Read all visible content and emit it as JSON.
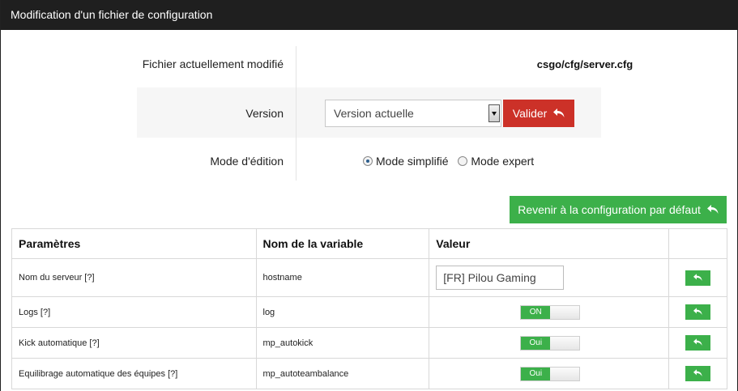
{
  "header": {
    "title": "Modification d'un fichier de configuration"
  },
  "info": {
    "file_label": "Fichier actuellement modifié",
    "file_value": "csgo/cfg/server.cfg",
    "version_label": "Version",
    "version_selected": "Version actuelle",
    "validate_label": "Valider",
    "mode_label": "Mode d'édition",
    "mode_simple": "Mode simplifié",
    "mode_expert": "Mode expert"
  },
  "reset_button": "Revenir à la configuration par défaut",
  "table": {
    "headers": [
      "Paramètres",
      "Nom de la variable",
      "Valeur",
      ""
    ],
    "rows": [
      {
        "param": "Nom du serveur [?]",
        "variable": "hostname",
        "value": "[FR] Pilou Gaming"
      },
      {
        "param": "Logs [?]",
        "variable": "log",
        "value": "ON"
      },
      {
        "param": "Kick automatique [?]",
        "variable": "mp_autokick",
        "value": "Oui"
      },
      {
        "param": "Equilibrage automatique des équipes [?]",
        "variable": "mp_autoteambalance",
        "value": "Oui"
      }
    ]
  },
  "colors": {
    "header_bg": "#1f1f1f",
    "danger": "#cc3128",
    "success": "#3cb04a"
  },
  "icons": {
    "reply": "reply-arrow-icon",
    "select": "chevron-down-icon"
  }
}
